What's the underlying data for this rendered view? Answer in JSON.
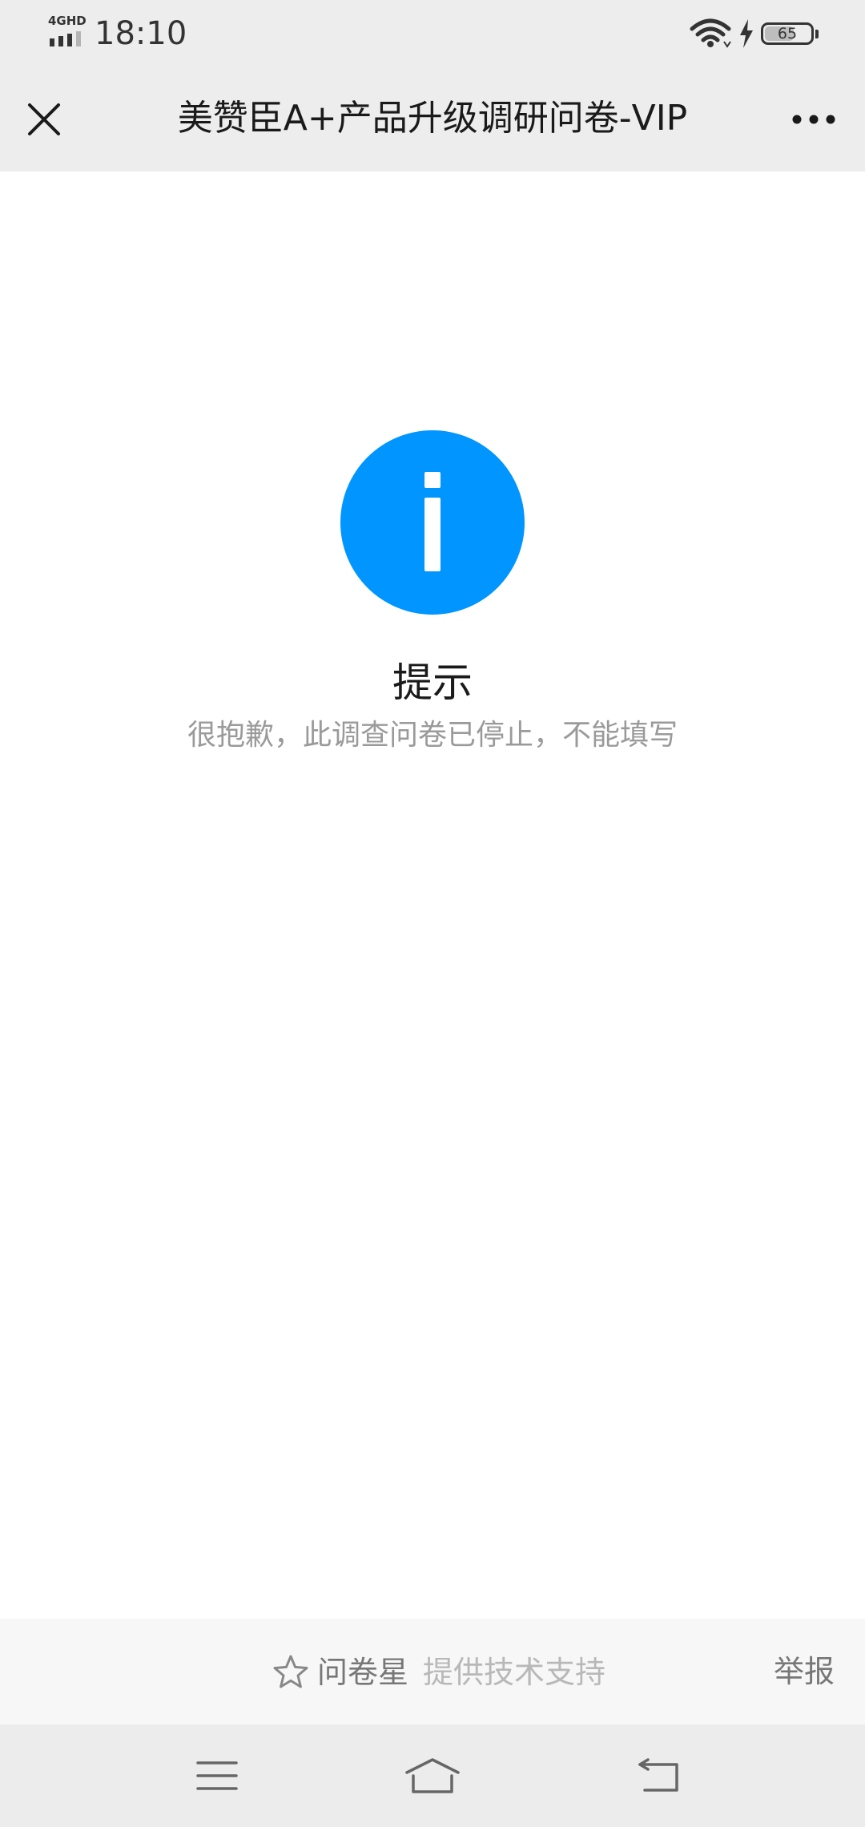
{
  "status_bar": {
    "network_label": "4GHD",
    "time": "18:10",
    "battery_level": "65",
    "battery_fraction": 0.65
  },
  "nav": {
    "title": "美赞臣A+产品升级调研问卷-VIP",
    "close_icon": "close-icon",
    "more_icon": "more-icon"
  },
  "prompt": {
    "icon": "info-icon",
    "icon_color": "#0095ff",
    "title": "提示",
    "message": "很抱歉，此调查问卷已停止，不能填写"
  },
  "footer": {
    "star_icon": "star-icon",
    "brand_name": "问卷星",
    "support_text": "提供技术支持",
    "report_label": "举报"
  },
  "system_nav": {
    "menu_icon": "menu-icon",
    "home_icon": "home-icon",
    "back_icon": "back-icon"
  }
}
